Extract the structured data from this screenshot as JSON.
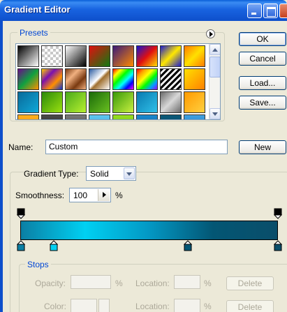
{
  "window": {
    "title": "Gradient Editor",
    "controls": [
      "minimize",
      "maximize",
      "close"
    ]
  },
  "presets": {
    "label": "Presets",
    "menu_icon": "right-arrow-circle-icon",
    "swatches": [
      [
        "black-white",
        "transparent-checker",
        "black-white-fade",
        "red-green",
        "violet-orange",
        "blue-red-yellow",
        "blue-yellow-blue",
        "orange-yellow-orange"
      ],
      [
        "violet-green-orange",
        "yellow-violet-orange-blue",
        "copper",
        "chrome",
        "spectrum",
        "transparent-rainbow",
        "transparent-stripes",
        "yellow-orange"
      ],
      [
        "blue-teal",
        "green-gradient",
        "green-light",
        "green-dark",
        "green-yellow",
        "teal-gradient",
        "steel-gray",
        "orange-light"
      ],
      [
        "orange-bottom",
        "dark-gray",
        "gray-black",
        "light-blue",
        "lime",
        "blue-deep",
        "teal-dark",
        "blue-light"
      ]
    ]
  },
  "buttons": {
    "ok": "OK",
    "cancel": "Cancel",
    "load": "Load...",
    "save": "Save...",
    "new": "New"
  },
  "name": {
    "label": "Name:",
    "value": "Custom"
  },
  "gradient": {
    "type_label": "Gradient Type:",
    "type_value": "Solid",
    "smoothness_label": "Smoothness:",
    "smoothness_value": "100",
    "smoothness_unit": "%",
    "colors": [
      "#0B7FA4",
      "#00D0F2",
      "#0398C4",
      "#035674",
      "#0A4E6A"
    ],
    "opacity_stops": [
      0.0,
      1.0
    ],
    "color_stops": [
      0.0,
      0.13,
      0.65,
      1.0
    ]
  },
  "stops": {
    "label": "Stops",
    "opacity_label": "Opacity:",
    "opacity_unit": "%",
    "location_label_1": "Location:",
    "location_unit_1": "%",
    "delete_label_1": "Delete",
    "color_label": "Color:",
    "location_label_2": "Location:",
    "location_unit_2": "%",
    "delete_label_2": "Delete"
  }
}
